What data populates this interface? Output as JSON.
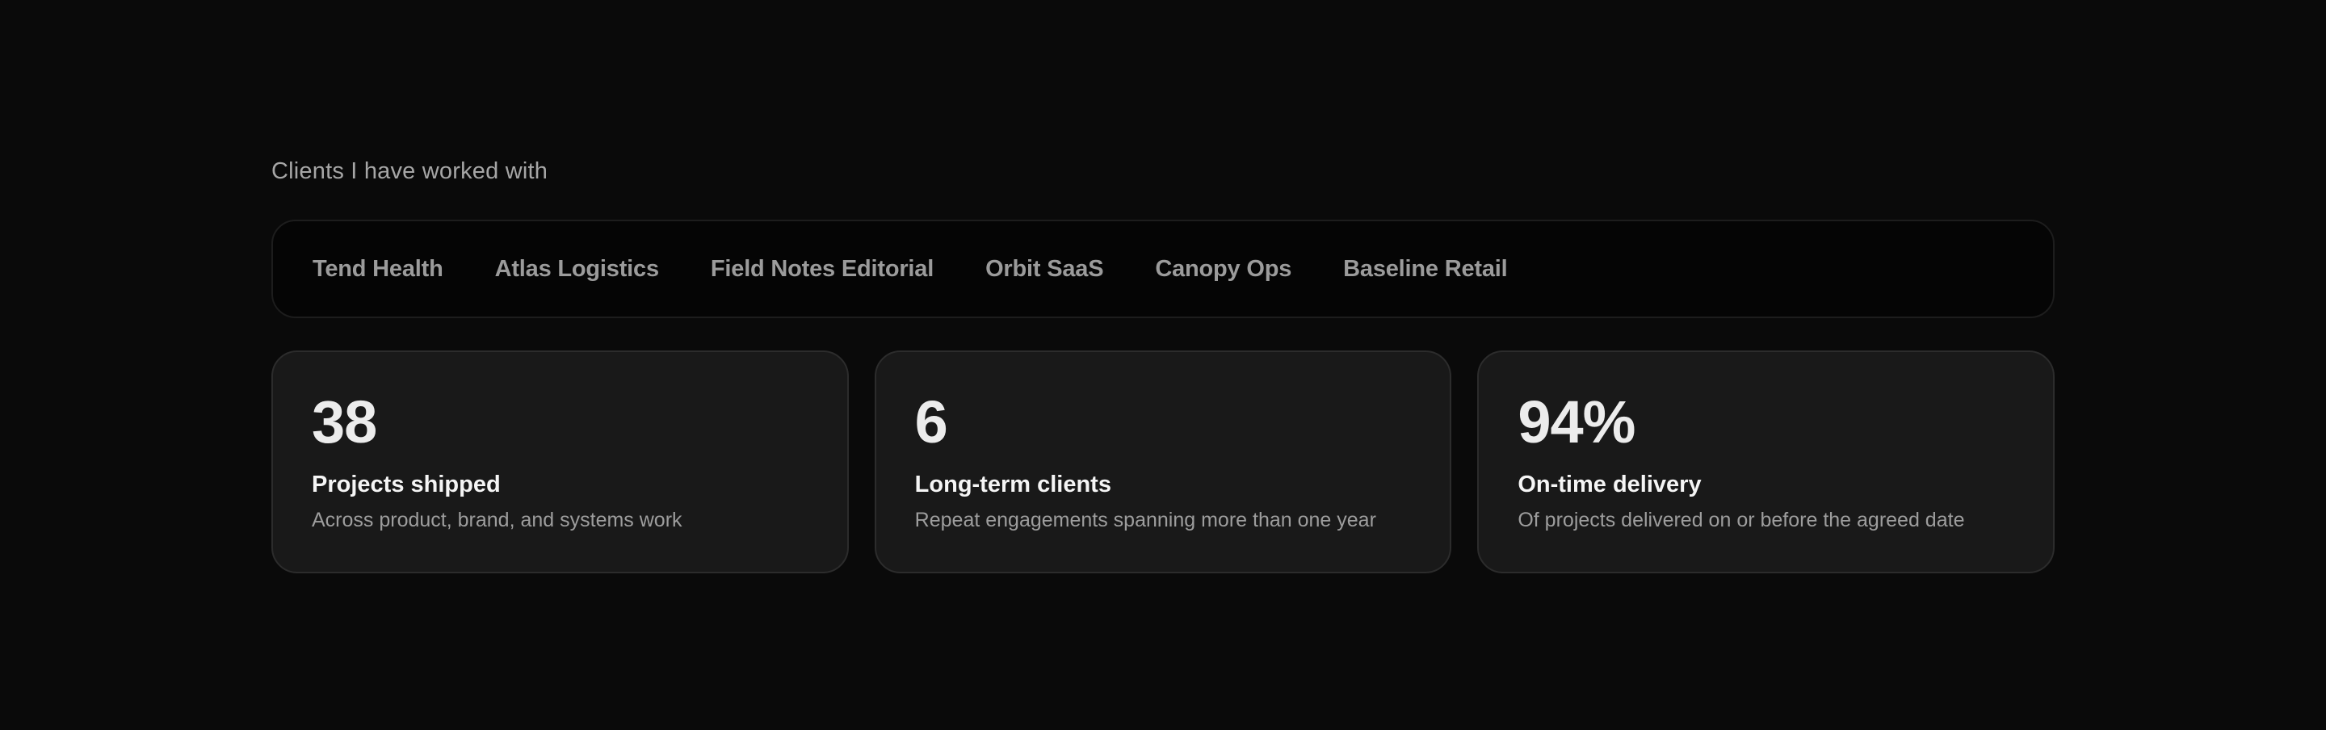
{
  "clients_section": {
    "heading": "Clients I have worked with",
    "clients": [
      "Tend Health",
      "Atlas Logistics",
      "Field Notes Editorial",
      "Orbit SaaS",
      "Canopy Ops",
      "Baseline Retail"
    ]
  },
  "stats": [
    {
      "value": "38",
      "label": "Projects shipped",
      "description": "Across product, brand, and systems work"
    },
    {
      "value": "6",
      "label": "Long-term clients",
      "description": "Repeat engagements spanning more than one year"
    },
    {
      "value": "94%",
      "label": "On-time delivery",
      "description": "Of projects delivered on or before the agreed date"
    }
  ],
  "colors": {
    "background": "#0a0a0a",
    "card_background": "#191919",
    "strip_background": "#050505",
    "heading_text": "#a6a6a6",
    "client_text": "#9b9b9b",
    "value_text": "#ececec",
    "label_text": "#f5f5f5",
    "description_text": "#9d9d9d"
  }
}
